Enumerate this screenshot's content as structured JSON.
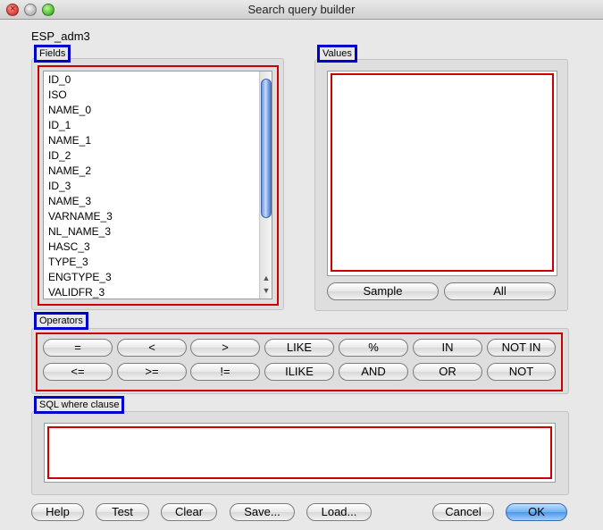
{
  "window": {
    "title": "Search query builder"
  },
  "layer": {
    "name": "ESP_adm3"
  },
  "fields": {
    "title": "Fields",
    "items": [
      "ID_0",
      "ISO",
      "NAME_0",
      "ID_1",
      "NAME_1",
      "ID_2",
      "NAME_2",
      "ID_3",
      "NAME_3",
      "VARNAME_3",
      "NL_NAME_3",
      "HASC_3",
      "TYPE_3",
      "ENGTYPE_3",
      "VALIDFR_3"
    ]
  },
  "values": {
    "title": "Values",
    "sample_label": "Sample",
    "all_label": "All"
  },
  "operators": {
    "title": "Operators",
    "row1": [
      "=",
      "<",
      ">",
      "LIKE",
      "%",
      "IN",
      "NOT IN"
    ],
    "row2": [
      "<=",
      ">=",
      "!=",
      "ILIKE",
      "AND",
      "OR",
      "NOT"
    ]
  },
  "sql": {
    "title": "SQL where clause",
    "value": ""
  },
  "bottom": {
    "help": "Help",
    "test": "Test",
    "clear": "Clear",
    "save": "Save...",
    "load": "Load...",
    "cancel": "Cancel",
    "ok": "OK"
  },
  "colors": {
    "highlight_red": "#cc0000",
    "highlight_blue": "#0000cc",
    "ok_blue": "#4d97e8"
  }
}
